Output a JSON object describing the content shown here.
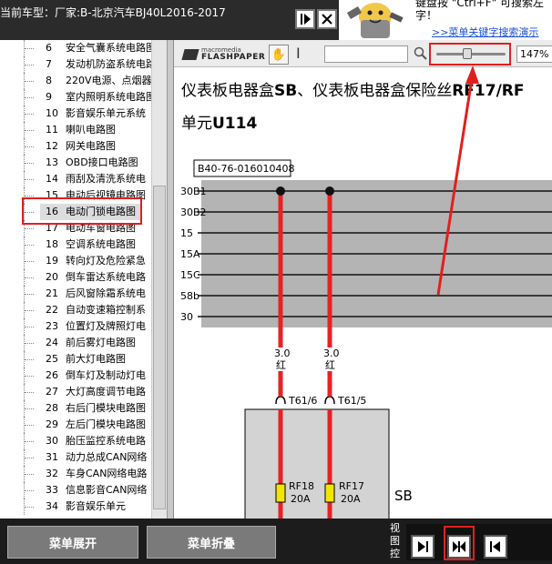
{
  "window": {
    "car_title": "当前车型：厂家:B-北京汽车BJ40L2016-2017"
  },
  "help": {
    "text_line1": "键盘按 \"Ctrl+F\" 可搜索左",
    "text_line2": "字！",
    "link": ">>菜单关键字搜索演示"
  },
  "tree": {
    "items": [
      {
        "num": "6",
        "label": "安全气囊系统电路图"
      },
      {
        "num": "7",
        "label": "发动机防盗系统电路"
      },
      {
        "num": "8",
        "label": "220V电源、点烟器"
      },
      {
        "num": "9",
        "label": "室内照明系统电路图"
      },
      {
        "num": "10",
        "label": "影音娱乐单元系统"
      },
      {
        "num": "11",
        "label": "喇叭电路图"
      },
      {
        "num": "12",
        "label": "网关电路图"
      },
      {
        "num": "13",
        "label": "OBD接口电路图"
      },
      {
        "num": "14",
        "label": "雨刮及清洗系统电"
      },
      {
        "num": "15",
        "label": "电动后视镜电路图"
      },
      {
        "num": "16",
        "label": "电动门锁电路图"
      },
      {
        "num": "17",
        "label": "电动车窗电路图"
      },
      {
        "num": "18",
        "label": "空调系统电路图"
      },
      {
        "num": "19",
        "label": "转向灯及危险紧急"
      },
      {
        "num": "20",
        "label": "倒车雷达系统电路"
      },
      {
        "num": "21",
        "label": "后风窗除霜系统电"
      },
      {
        "num": "22",
        "label": "自动变速箱控制系"
      },
      {
        "num": "23",
        "label": "位置灯及牌照灯电"
      },
      {
        "num": "24",
        "label": "前后雾灯电路图"
      },
      {
        "num": "25",
        "label": "前大灯电路图"
      },
      {
        "num": "26",
        "label": "倒车灯及制动灯电"
      },
      {
        "num": "27",
        "label": "大灯高度调节电路"
      },
      {
        "num": "28",
        "label": "右后门模块电路图"
      },
      {
        "num": "29",
        "label": "左后门模块电路图"
      },
      {
        "num": "30",
        "label": "胎压监控系统电路"
      },
      {
        "num": "31",
        "label": "动力总成CAN网络"
      },
      {
        "num": "32",
        "label": "车身CAN网络电路"
      },
      {
        "num": "33",
        "label": "信息影音CAN网络"
      },
      {
        "num": "34",
        "label": "影音娱乐单元"
      }
    ],
    "selected_index": 10
  },
  "viewer": {
    "logo_line1": "macromedia",
    "logo_line2": "FLASHPAPER",
    "search_value": "",
    "zoom": "147%",
    "zoom_level": 0.45,
    "title_line1_a": "仪表板电器盒",
    "title_line1_b": "SB",
    "title_line1_c": "、仪表板电器盒保险丝",
    "title_line1_d": "RF17/RF",
    "title_line2_a": "单元",
    "title_line2_b": "U114"
  },
  "diagram": {
    "part_number": "B40-76-016010408",
    "bus_labels": [
      "30B1",
      "30B2",
      "15",
      "15A",
      "15C",
      "58b",
      "30"
    ],
    "wires": [
      {
        "gauge": "3.0",
        "color": "红",
        "terminal": "T61/6",
        "fuse": "RF18",
        "amps": "20A"
      },
      {
        "gauge": "3.0",
        "color": "红",
        "terminal": "T61/5",
        "fuse": "RF17",
        "amps": "20A"
      }
    ],
    "box_label": "SB"
  },
  "bottom": {
    "expand_label": "菜单展开",
    "collapse_label": "菜单折叠",
    "view_label": "视图控"
  },
  "colors": {
    "accent_red": "#e0201f",
    "wire_red": "#e52226",
    "bus_gray": "#b4b4b4",
    "fuse_yellow": "#f2e600"
  }
}
